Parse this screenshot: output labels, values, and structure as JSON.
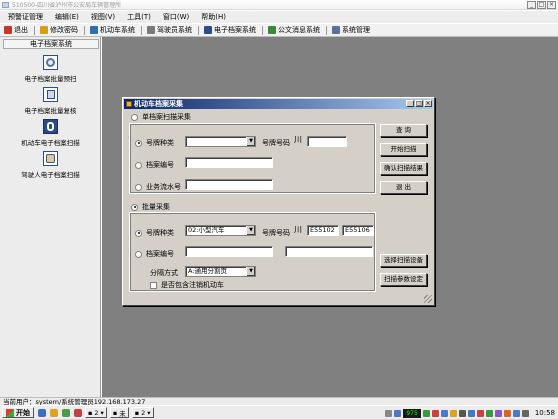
{
  "window": {
    "title": "510500-四川省泸州市公安局车辆管理所"
  },
  "menu": [
    "预警证管理",
    "编辑(E)",
    "视图(V)",
    "工具(T)",
    "窗口(W)",
    "帮助(H)"
  ],
  "toolbar": [
    {
      "label": "退出",
      "icon": "exit-icon",
      "color": "#c0392b"
    },
    {
      "label": "修改密码",
      "icon": "key-icon",
      "color": "#d4a017"
    },
    {
      "label": "机动车系统",
      "icon": "car-icon",
      "color": "#2e6db4"
    },
    {
      "label": "驾驶员系统",
      "icon": "driver-icon",
      "color": "#7a7a7a"
    },
    {
      "label": "电子档案系统",
      "icon": "archive-icon",
      "color": "#2b4d8a"
    },
    {
      "label": "公文消息系统",
      "icon": "message-icon",
      "color": "#3a8a3a"
    },
    {
      "label": "系统管理",
      "icon": "settings-icon",
      "color": "#5a6fa8"
    }
  ],
  "sidebar": {
    "header": "电子档案系统",
    "items": [
      {
        "label": "电子档案批量预扫",
        "icon": "disc-icon"
      },
      {
        "label": "电子档案批量复核",
        "icon": "document-icon"
      },
      {
        "label": "机动车电子档案扫描",
        "icon": "car-archive-icon"
      },
      {
        "label": "驾驶人电子档案扫描",
        "icon": "driver-archive-icon"
      }
    ]
  },
  "dialog": {
    "title": "机动车档案采集",
    "single": {
      "label": "单档案扫描采集",
      "plate_type_label": "号牌种类",
      "plate_type_value": "",
      "plate_no_label": "号牌号码",
      "plate_no_prefix": "川",
      "plate_no_value": "",
      "archive_no_label": "档案编号",
      "archive_no_value": "",
      "flow_no_label": "业务流水号",
      "flow_no_value": ""
    },
    "batch": {
      "label": "批量采集",
      "plate_type_label": "号牌种类",
      "plate_type_value": "02:小型汽车",
      "plate_no_label": "号牌号码",
      "plate_no_prefix": "川",
      "plate_no_from": "E55102",
      "plate_no_to": "E55106",
      "archive_no_label": "档案编号",
      "archive_from": "",
      "archive_to": "",
      "split_label": "分隔方式",
      "split_value": "A:通用分割页",
      "include_cancelled_label": "是否包含注销机动车"
    },
    "buttons": {
      "query": "查 询",
      "start_scan": "开始扫描",
      "confirm": "确认扫描结果",
      "exit": "退 出",
      "choose_device": "选择扫描设备",
      "scan_params": "扫描参数设定"
    }
  },
  "status": {
    "text": "当前用户：system/系统管理员192.168.173.27"
  },
  "taskbar": {
    "start": "开始",
    "task1": "2",
    "task2": "未",
    "task3": "2",
    "net": "975",
    "clock": "10:58"
  }
}
